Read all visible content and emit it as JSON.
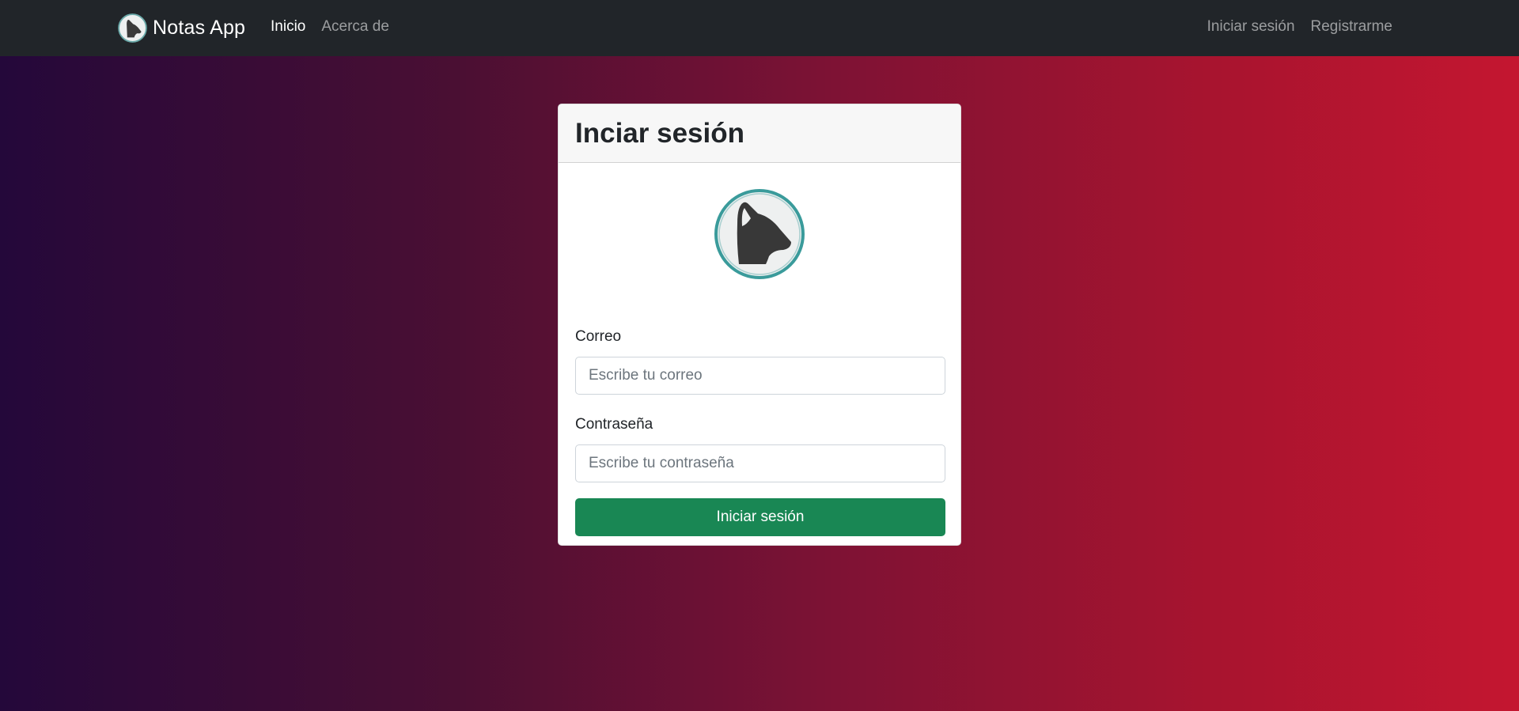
{
  "navbar": {
    "brand_name": "Notas App",
    "brand_icon": "cat-logo-icon",
    "left_links": [
      {
        "label": "Inicio",
        "active": true
      },
      {
        "label": "Acerca de",
        "active": false
      }
    ],
    "right_links": [
      {
        "label": "Iniciar sesión"
      },
      {
        "label": "Registrarme"
      }
    ]
  },
  "login_card": {
    "title": "Inciar sesión",
    "avatar_icon": "cat-avatar-icon",
    "email": {
      "label": "Correo",
      "placeholder": "Escribe tu correo",
      "value": ""
    },
    "password": {
      "label": "Contraseña",
      "placeholder": "Escribe tu contraseña",
      "value": ""
    },
    "submit_label": "Iniciar sesión"
  },
  "colors": {
    "navbar_bg": "#212529",
    "gradient_start": "#24083a",
    "gradient_end": "#c41630",
    "button_green": "#198754",
    "avatar_ring": "#3a9b9b"
  }
}
